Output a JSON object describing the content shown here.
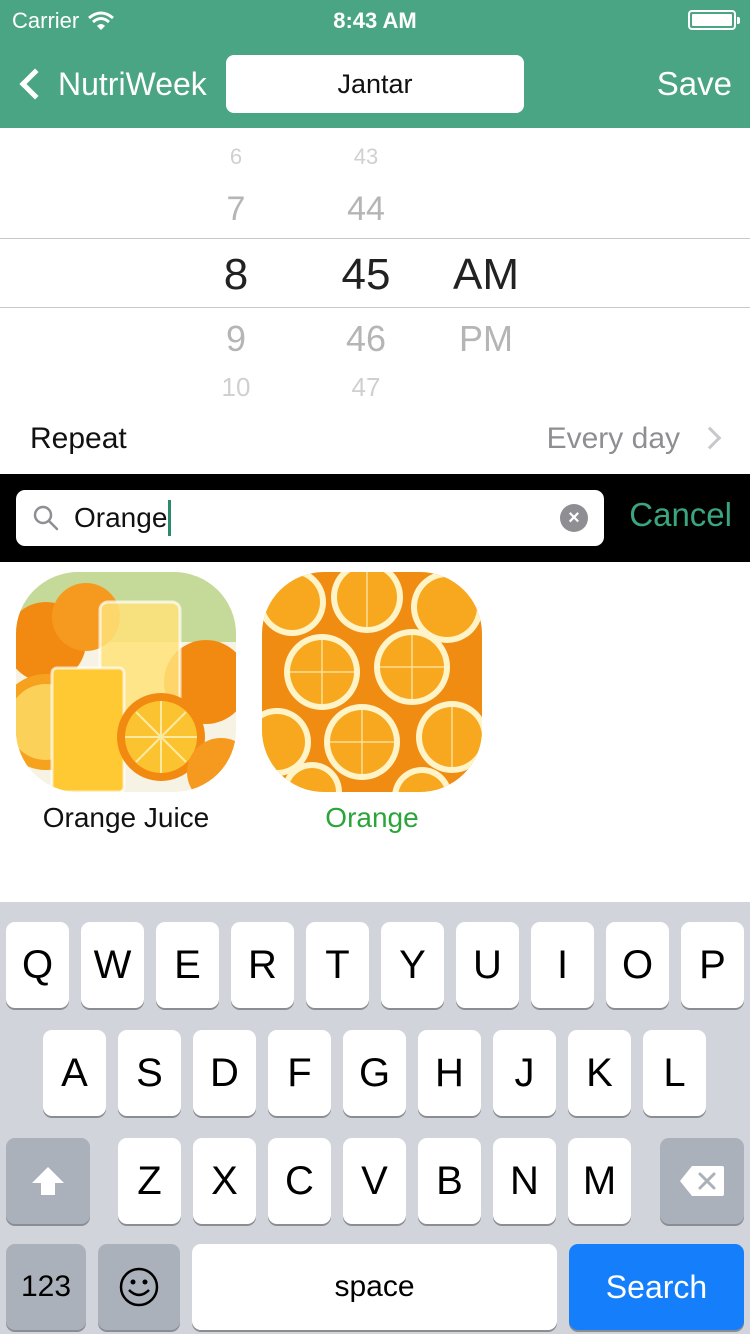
{
  "status_bar": {
    "carrier": "Carrier",
    "time": "8:43 AM"
  },
  "nav": {
    "back_label": "NutriWeek",
    "title_value": "Jantar",
    "save_label": "Save"
  },
  "time_picker": {
    "hours": [
      "6",
      "7",
      "8",
      "9",
      "10"
    ],
    "minutes": [
      "43",
      "44",
      "45",
      "46",
      "47"
    ],
    "periods": [
      "AM",
      "PM"
    ],
    "selected": {
      "hour": "8",
      "minute": "45",
      "period": "AM"
    }
  },
  "repeat": {
    "label": "Repeat",
    "value": "Every day"
  },
  "search": {
    "query": "Orange",
    "cancel_label": "Cancel"
  },
  "results": [
    {
      "name": "Orange Juice",
      "selected": false
    },
    {
      "name": "Orange",
      "selected": true
    }
  ],
  "colors": {
    "nav_green": "#4aa584",
    "accent_green": "#3aa57f",
    "selected_caption": "#2aa53a",
    "search_key_blue": "#157efb"
  },
  "keyboard": {
    "row1": [
      "Q",
      "W",
      "E",
      "R",
      "T",
      "Y",
      "U",
      "I",
      "O",
      "P"
    ],
    "row2": [
      "A",
      "S",
      "D",
      "F",
      "G",
      "H",
      "J",
      "K",
      "L"
    ],
    "row3": [
      "Z",
      "X",
      "C",
      "V",
      "B",
      "N",
      "M"
    ],
    "numbers_label": "123",
    "space_label": "space",
    "action_label": "Search",
    "shift_icon": "shift-arrow-icon",
    "delete_icon": "backspace-icon",
    "emoji_icon": "emoji-smiley-icon"
  }
}
